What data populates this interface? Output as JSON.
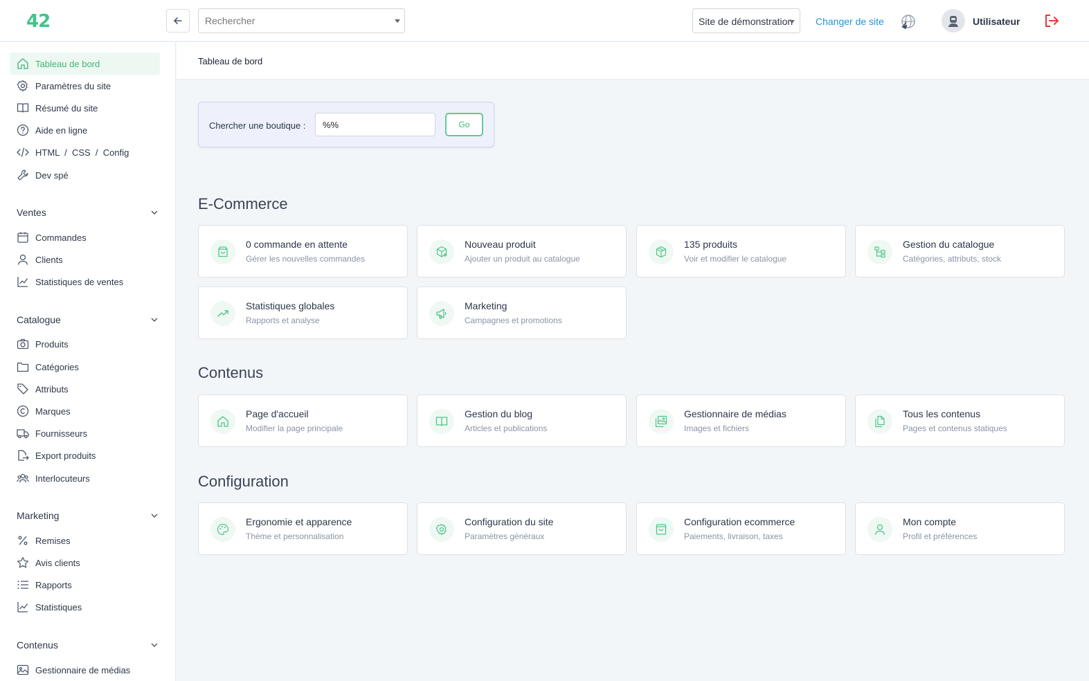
{
  "header": {
    "logo": "42",
    "search_placeholder": "Rechercher",
    "site_select": "Site de démonstration",
    "change_site": "Changer de site",
    "user_name": "Utilisateur"
  },
  "sidebar": {
    "top_items": [
      {
        "label": "Tableau de bord",
        "icon": "home-icon",
        "active": true
      },
      {
        "label": "Paramètres du site",
        "icon": "gear-icon"
      },
      {
        "label": "Résumé du site",
        "icon": "book-icon"
      },
      {
        "label": "Aide en ligne",
        "icon": "help-icon"
      },
      {
        "label": "HTML  /  CSS  /  Config",
        "icon": "code-icon"
      },
      {
        "label": "Dev spé",
        "icon": "wrench-icon"
      }
    ],
    "sections": [
      {
        "title": "Ventes",
        "items": [
          {
            "label": "Commandes",
            "icon": "calendar-box-icon"
          },
          {
            "label": "Clients",
            "icon": "user-icon"
          },
          {
            "label": "Statistiques de ventes",
            "icon": "line-chart-icon"
          }
        ]
      },
      {
        "title": "Catalogue",
        "items": [
          {
            "label": "Produits",
            "icon": "camera-icon"
          },
          {
            "label": "Catégories",
            "icon": "folder-icon"
          },
          {
            "label": "Attributs",
            "icon": "tags-icon"
          },
          {
            "label": "Marques",
            "icon": "copyright-icon"
          },
          {
            "label": "Fournisseurs",
            "icon": "truck-icon"
          },
          {
            "label": "Export produits",
            "icon": "file-export-icon"
          },
          {
            "label": "Interlocuteurs",
            "icon": "users-icon"
          }
        ]
      },
      {
        "title": "Marketing",
        "items": [
          {
            "label": "Remises",
            "icon": "percent-icon"
          },
          {
            "label": "Avis clients",
            "icon": "star-icon"
          },
          {
            "label": "Rapports",
            "icon": "list-icon"
          },
          {
            "label": "Statistiques",
            "icon": "line-chart-icon"
          }
        ]
      },
      {
        "title": "Contenus",
        "items": [
          {
            "label": "Gestionnaire de médias",
            "icon": "image-icon"
          }
        ]
      }
    ]
  },
  "main": {
    "breadcrumb": "Tableau de bord",
    "shop_search": {
      "label": "Chercher une boutique :",
      "value": "%%",
      "go": "Go"
    },
    "sections": [
      {
        "title": "E-Commerce",
        "cards": [
          {
            "title": "0 commande en attente",
            "subtitle": "Gérer les nouvelles commandes",
            "icon": "shopping-bag-icon"
          },
          {
            "title": "Nouveau produit",
            "subtitle": "Ajouter un produit au catalogue",
            "icon": "box-plus-icon"
          },
          {
            "title": "135 produits",
            "subtitle": "Voir et modifier le catalogue",
            "icon": "cube-icon"
          },
          {
            "title": "Gestion du catalogue",
            "subtitle": "Catégories, attributs, stock",
            "icon": "hierarchy-icon"
          },
          {
            "title": "Statistiques globales",
            "subtitle": "Rapports et analyse",
            "icon": "trend-up-icon"
          },
          {
            "title": "Marketing",
            "subtitle": "Campagnes et promotions",
            "icon": "megaphone-icon"
          }
        ]
      },
      {
        "title": "Contenus",
        "cards": [
          {
            "title": "Page d'accueil",
            "subtitle": "Modifier la page principale",
            "icon": "home-icon"
          },
          {
            "title": "Gestion du blog",
            "subtitle": "Articles et publications",
            "icon": "open-book-icon"
          },
          {
            "title": "Gestionnaire de médias",
            "subtitle": "Images et fichiers",
            "icon": "images-icon"
          },
          {
            "title": "Tous les contenus",
            "subtitle": "Pages et contenus statiques",
            "icon": "documents-icon"
          }
        ]
      },
      {
        "title": "Configuration",
        "cards": [
          {
            "title": "Ergonomie et apparence",
            "subtitle": "Thème et personnalisation",
            "icon": "palette-icon"
          },
          {
            "title": "Configuration du site",
            "subtitle": "Paramètres généraux",
            "icon": "gear-icon"
          },
          {
            "title": "Configuration ecommerce",
            "subtitle": "Paiements, livraison, taxes",
            "icon": "bag-icon"
          },
          {
            "title": "Mon compte",
            "subtitle": "Profil et préférences",
            "icon": "user-icon"
          }
        ]
      }
    ]
  },
  "colors": {
    "accent": "#3fc58a",
    "link": "#2196d3",
    "logout": "#e53935"
  }
}
